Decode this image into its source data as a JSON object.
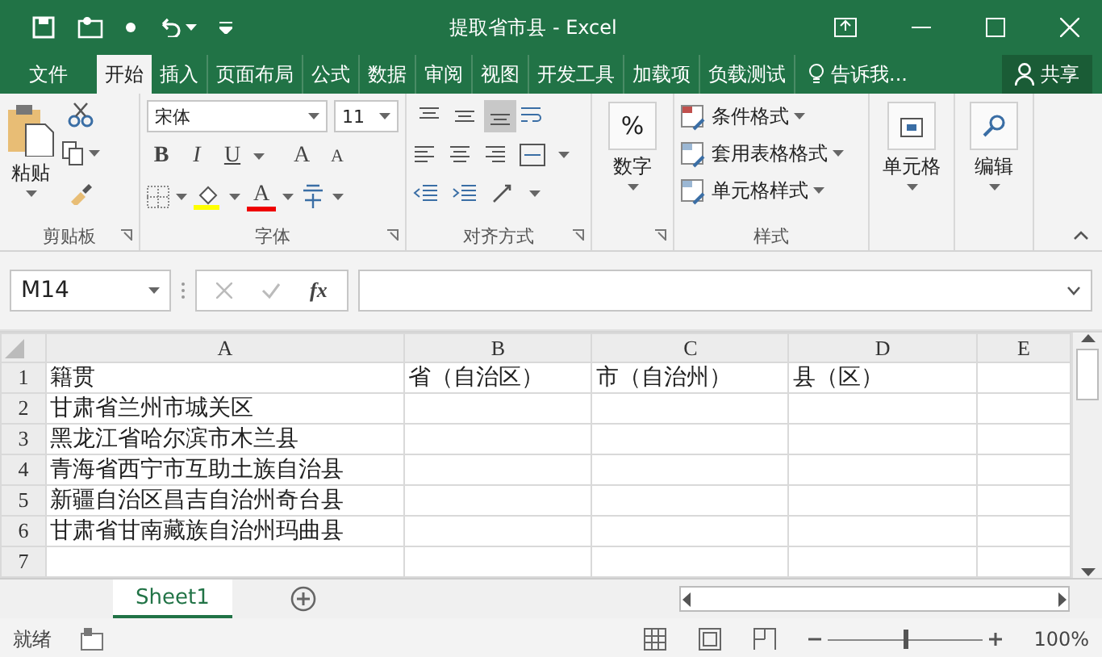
{
  "window": {
    "title": "提取省市县 - Excel"
  },
  "ribbon_tabs": [
    {
      "label": "文件",
      "selected": false
    },
    {
      "label": "开始",
      "selected": true
    },
    {
      "label": "插入",
      "selected": false
    },
    {
      "label": "页面布局",
      "selected": false
    },
    {
      "label": "公式",
      "selected": false
    },
    {
      "label": "数据",
      "selected": false
    },
    {
      "label": "审阅",
      "selected": false
    },
    {
      "label": "视图",
      "selected": false
    },
    {
      "label": "开发工具",
      "selected": false
    },
    {
      "label": "加载项",
      "selected": false
    },
    {
      "label": "负载测试",
      "selected": false
    }
  ],
  "tell_me": "告诉我...",
  "share": "共享",
  "ribbon": {
    "clipboard": {
      "paste": "粘贴",
      "label": "剪贴板"
    },
    "font": {
      "font_name": "宋体",
      "font_size": "11",
      "bold": "B",
      "italic": "I",
      "underline": "U",
      "grow": "A",
      "shrink": "A",
      "font_color": "A",
      "label": "字体"
    },
    "alignment": {
      "top_buttons": [
        {
          "selected": false
        },
        {
          "selected": false
        },
        {
          "selected": true
        }
      ],
      "label": "对齐方式"
    },
    "number": {
      "symbol": "%",
      "label": "数字"
    },
    "styles": {
      "items": [
        "条件格式",
        "套用表格格式",
        "单元格样式"
      ],
      "label": "样式"
    },
    "cells": {
      "label": "单元格"
    },
    "editing": {
      "label": "编辑"
    }
  },
  "formula_bar": {
    "name_box": "M14",
    "function_label": "fx"
  },
  "sheet": {
    "columns": [
      "A",
      "B",
      "C",
      "D",
      "E"
    ],
    "rows": [
      {
        "number": "1",
        "cells": [
          "籍贯",
          "省（自治区）",
          "市（自治州）",
          "县（区）"
        ]
      },
      {
        "number": "2",
        "cells": [
          "甘肃省兰州市城关区"
        ]
      },
      {
        "number": "3",
        "cells": [
          "黑龙江省哈尔滨市木兰县"
        ]
      },
      {
        "number": "4",
        "cells": [
          "青海省西宁市互助土族自治县"
        ]
      },
      {
        "number": "5",
        "cells": [
          "新疆自治区昌吉自治州奇台县"
        ]
      },
      {
        "number": "6",
        "cells": [
          "甘肃省甘南藏族自治州玛曲县"
        ]
      },
      {
        "number": "7"
      }
    ]
  },
  "sheet_tabs": [
    {
      "label": "Sheet1",
      "selected": true
    }
  ],
  "status_bar": {
    "status": "就绪",
    "zoom_slider": {
      "level": 0.5
    },
    "zoom": "100%"
  }
}
